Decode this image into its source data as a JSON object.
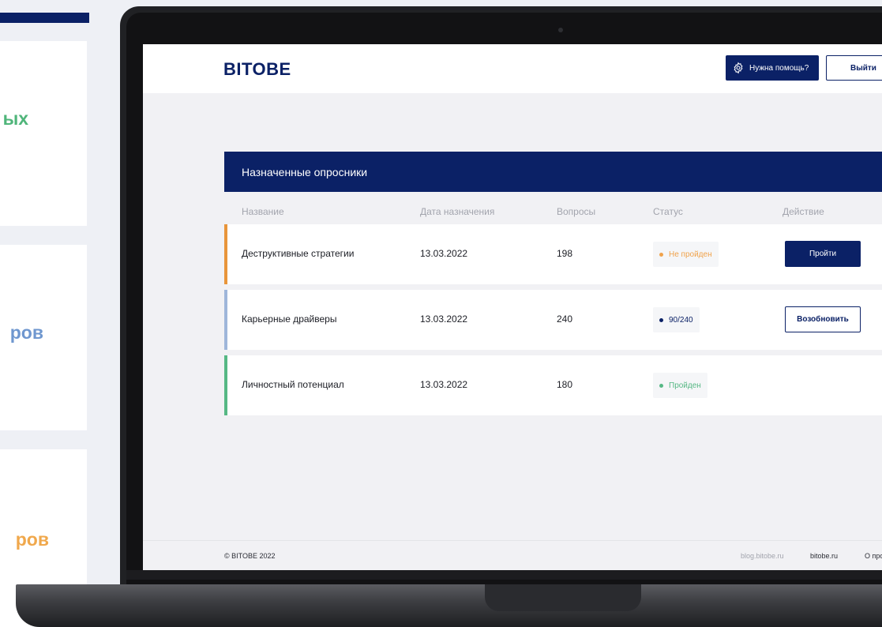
{
  "side_cards": [
    {
      "word": "ых"
    },
    {
      "word": "ров"
    },
    {
      "word": "ров"
    }
  ],
  "app": {
    "logo": "BITOBE",
    "help_label": "Нужна помощь?",
    "logout_label": "Выйти",
    "panel_title": "Назначенные опросники",
    "columns": [
      "Название",
      "Дата назначения",
      "Вопросы",
      "Статус",
      "Действие"
    ],
    "rows": [
      {
        "name": "Деструктивные стратегии",
        "date": "13.03.2022",
        "questions": "198",
        "status": "Не пройден",
        "action": "Пройти",
        "accent": "#e8953a",
        "status_color": "#f0a24a",
        "text_color": "#f0a24a"
      },
      {
        "name": "Карьерные драйверы",
        "date": "13.03.2022",
        "questions": "240",
        "status": "90/240",
        "action": "Возобновить",
        "accent": "#9fb6da",
        "status_color": "#0b2166",
        "text_color": "#0b2166"
      },
      {
        "name": "Личностный потенциал",
        "date": "13.03.2022",
        "questions": "180",
        "status": "Пройден",
        "action": "",
        "accent": "#56b884",
        "status_color": "#56b884",
        "text_color": "#56b884"
      }
    ],
    "footer": {
      "copyright": "© BITOBE 2022",
      "links": [
        "blog.bitobe.ru",
        "bitobe.ru",
        "О про"
      ]
    }
  }
}
